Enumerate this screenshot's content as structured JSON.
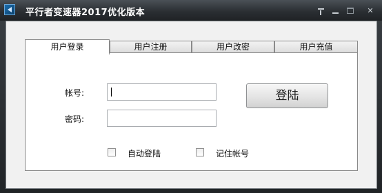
{
  "window": {
    "title": "平行者变速器2017优化版本",
    "icon": "app-icon",
    "controls": [
      "help-icon",
      "minimize-icon",
      "maximize-icon",
      "close-icon"
    ]
  },
  "tabs": [
    {
      "label": "用户登录",
      "active": true
    },
    {
      "label": "用户注册",
      "active": false
    },
    {
      "label": "用户改密",
      "active": false
    },
    {
      "label": "用户充值",
      "active": false
    }
  ],
  "login": {
    "username_label": "帐号:",
    "username_value": "",
    "password_label": "密码:",
    "password_value": "",
    "login_button": "登陆",
    "auto_login_label": "自动登陆",
    "auto_login_checked": false,
    "remember_label": "记住帐号",
    "remember_checked": false
  }
}
